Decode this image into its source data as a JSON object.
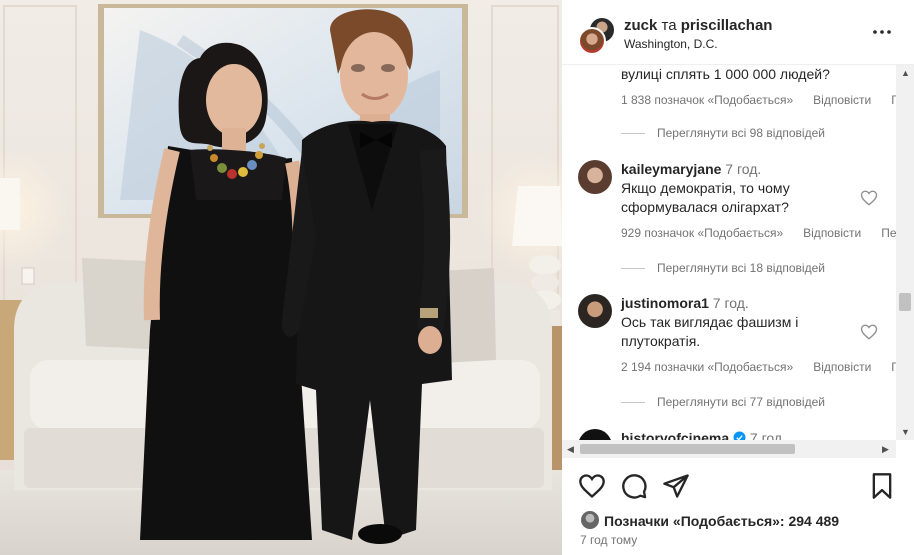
{
  "post": {
    "author1": "zuck",
    "joiner": "та",
    "author2": "priscillachan",
    "location": "Washington, D.C.",
    "likes_label": "Позначки «Подобається»: 294 489",
    "time_ago": "7 год тому"
  },
  "comments": [
    {
      "text": "вулиці сплять 1 000 000 людей?",
      "likes": "1 838 позначок «Подобається»",
      "reply": "Відповісти",
      "extra": "Г",
      "view_replies": "Переглянути всі 98 відповідей"
    },
    {
      "user": "kaileymaryjane",
      "time": "7 год.",
      "text_line1": "Якщо демократія, то чому",
      "text_line2": "сформувалася олігархат?",
      "likes": "929 позначок «Подобається»",
      "reply": "Відповісти",
      "extra": "Пе",
      "view_replies": "Переглянути всі 18 відповідей"
    },
    {
      "user": "justinomora1",
      "time": "7 год.",
      "text_line1": "Ось так виглядає фашизм і",
      "text_line2": "плутократія.",
      "likes": "2 194 позначки «Подобається»",
      "reply": "Відповісти",
      "extra": "Г",
      "view_replies": "Переглянути всі 77 відповідей"
    },
    {
      "user": "historyofcinema",
      "time": "7 год.",
      "verified": true
    }
  ],
  "icons": {
    "more": "more-horizontal-icon",
    "like": "heart-icon",
    "comment": "comment-icon",
    "share": "share-icon",
    "save": "bookmark-icon",
    "verified_color": "#0095f6"
  }
}
